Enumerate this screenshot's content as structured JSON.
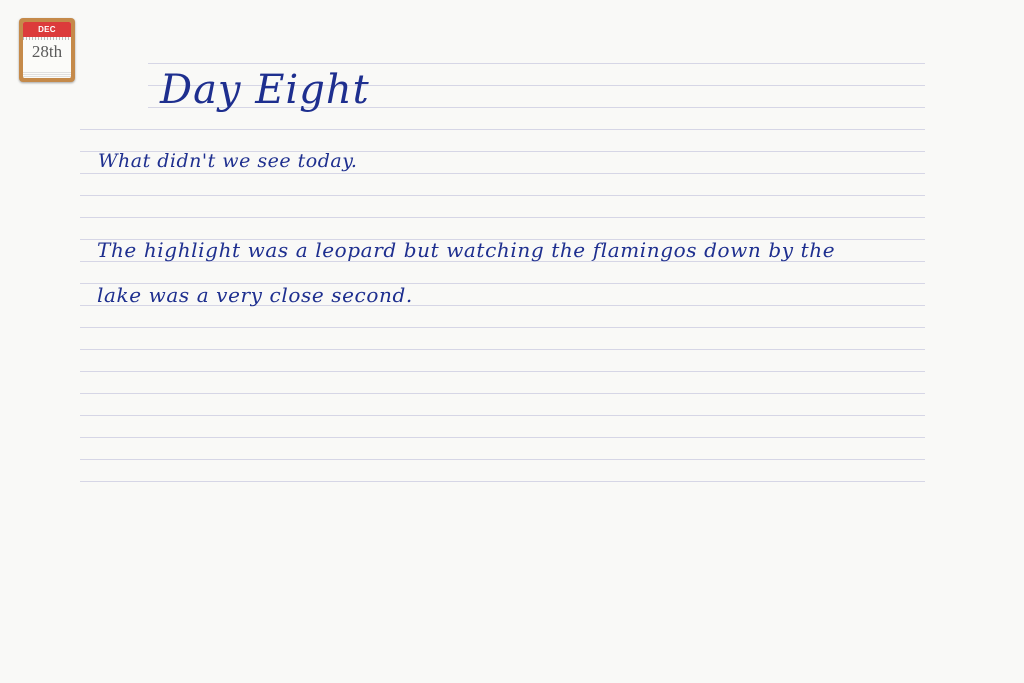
{
  "calendar": {
    "month": "DEC",
    "day": "28th"
  },
  "journal": {
    "title": "Day Eight",
    "question": "What didn't we see today.",
    "body_lines": [
      "The highlight was a leopard but watching the flamingos down by the",
      "lake was a very close second."
    ]
  },
  "colors": {
    "ink": "#1e2f8f",
    "rule": "#d6d6e6",
    "calendar_header": "#dc3b3b",
    "calendar_frame": "#c58a4a",
    "paper": "#f9f9f7"
  }
}
